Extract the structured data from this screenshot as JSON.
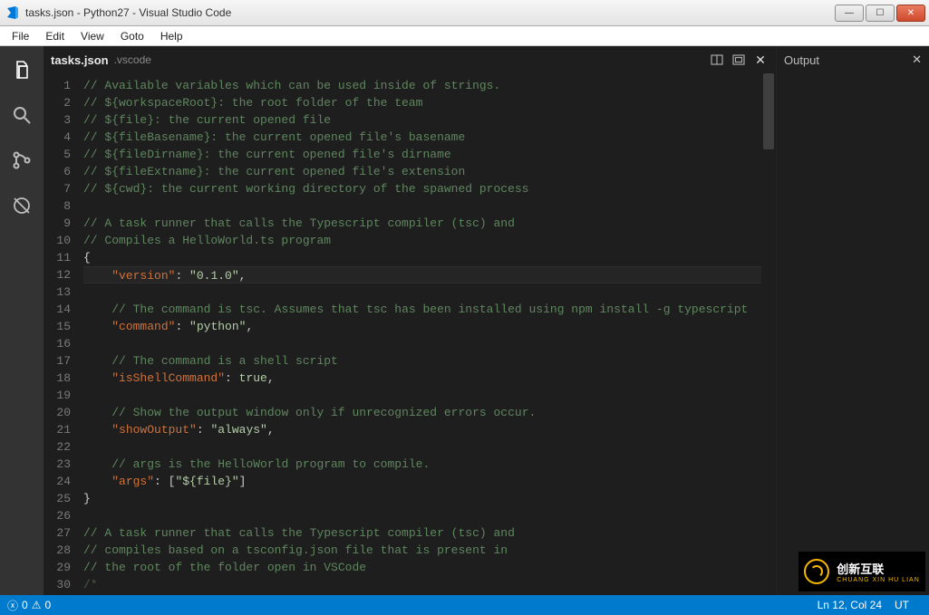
{
  "window": {
    "title": "tasks.json - Python27 - Visual Studio Code"
  },
  "menus": [
    "File",
    "Edit",
    "View",
    "Goto",
    "Help"
  ],
  "activity": [
    {
      "name": "explorer-icon",
      "active": true
    },
    {
      "name": "search-icon",
      "active": false
    },
    {
      "name": "git-icon",
      "active": false
    },
    {
      "name": "debug-icon",
      "active": false
    }
  ],
  "tab": {
    "filename": "tasks.json",
    "folder": ".vscode"
  },
  "output_panel": {
    "title": "Output"
  },
  "statusbar": {
    "errors": "0",
    "warnings": "0",
    "position": "Ln 12, Col 24",
    "encoding": "UT"
  },
  "code": {
    "current_line": 12,
    "lines": [
      {
        "n": 1,
        "type": "comment",
        "text": "// Available variables which can be used inside of strings."
      },
      {
        "n": 2,
        "type": "comment",
        "text": "// ${workspaceRoot}: the root folder of the team"
      },
      {
        "n": 3,
        "type": "comment",
        "text": "// ${file}: the current opened file"
      },
      {
        "n": 4,
        "type": "comment",
        "text": "// ${fileBasename}: the current opened file's basename"
      },
      {
        "n": 5,
        "type": "comment",
        "text": "// ${fileDirname}: the current opened file's dirname"
      },
      {
        "n": 6,
        "type": "comment",
        "text": "// ${fileExtname}: the current opened file's extension"
      },
      {
        "n": 7,
        "type": "comment",
        "text": "// ${cwd}: the current working directory of the spawned process"
      },
      {
        "n": 8,
        "type": "blank",
        "text": ""
      },
      {
        "n": 9,
        "type": "comment",
        "text": "// A task runner that calls the Typescript compiler (tsc) and"
      },
      {
        "n": 10,
        "type": "comment",
        "text": "// Compiles a HelloWorld.ts program"
      },
      {
        "n": 11,
        "type": "brace",
        "text": "{"
      },
      {
        "n": 12,
        "type": "kv",
        "key": "\"version\"",
        "value": "\"0.1.0\"",
        "trail": ","
      },
      {
        "n": 13,
        "type": "blank",
        "text": ""
      },
      {
        "n": 14,
        "type": "comment_indent",
        "text": "// The command is tsc. Assumes that tsc has been installed using npm install -g typescript"
      },
      {
        "n": 15,
        "type": "kv",
        "key": "\"command\"",
        "value": "\"python\"",
        "trail": ","
      },
      {
        "n": 16,
        "type": "blank",
        "text": ""
      },
      {
        "n": 17,
        "type": "comment_indent",
        "text": "// The command is a shell script"
      },
      {
        "n": 18,
        "type": "kv",
        "key": "\"isShellCommand\"",
        "value": "true",
        "trail": ","
      },
      {
        "n": 19,
        "type": "blank",
        "text": ""
      },
      {
        "n": 20,
        "type": "comment_indent",
        "text": "// Show the output window only if unrecognized errors occur."
      },
      {
        "n": 21,
        "type": "kv",
        "key": "\"showOutput\"",
        "value": "\"always\"",
        "trail": ","
      },
      {
        "n": 22,
        "type": "blank",
        "text": ""
      },
      {
        "n": 23,
        "type": "comment_indent",
        "text": "// args is the HelloWorld program to compile."
      },
      {
        "n": 24,
        "type": "kv_arr",
        "key": "\"args\"",
        "value": "\"${file}\"",
        "trail": ""
      },
      {
        "n": 25,
        "type": "brace",
        "text": "}"
      },
      {
        "n": 26,
        "type": "blank",
        "text": ""
      },
      {
        "n": 27,
        "type": "comment",
        "text": "// A task runner that calls the Typescript compiler (tsc) and"
      },
      {
        "n": 28,
        "type": "comment",
        "text": "// compiles based on a tsconfig.json file that is present in"
      },
      {
        "n": 29,
        "type": "comment",
        "text": "// the root of the folder open in VSCode"
      },
      {
        "n": 30,
        "type": "dim",
        "text": "/*"
      }
    ]
  },
  "watermark": {
    "main": "创新互联",
    "sub": "CHUANG XIN HU LIAN"
  }
}
